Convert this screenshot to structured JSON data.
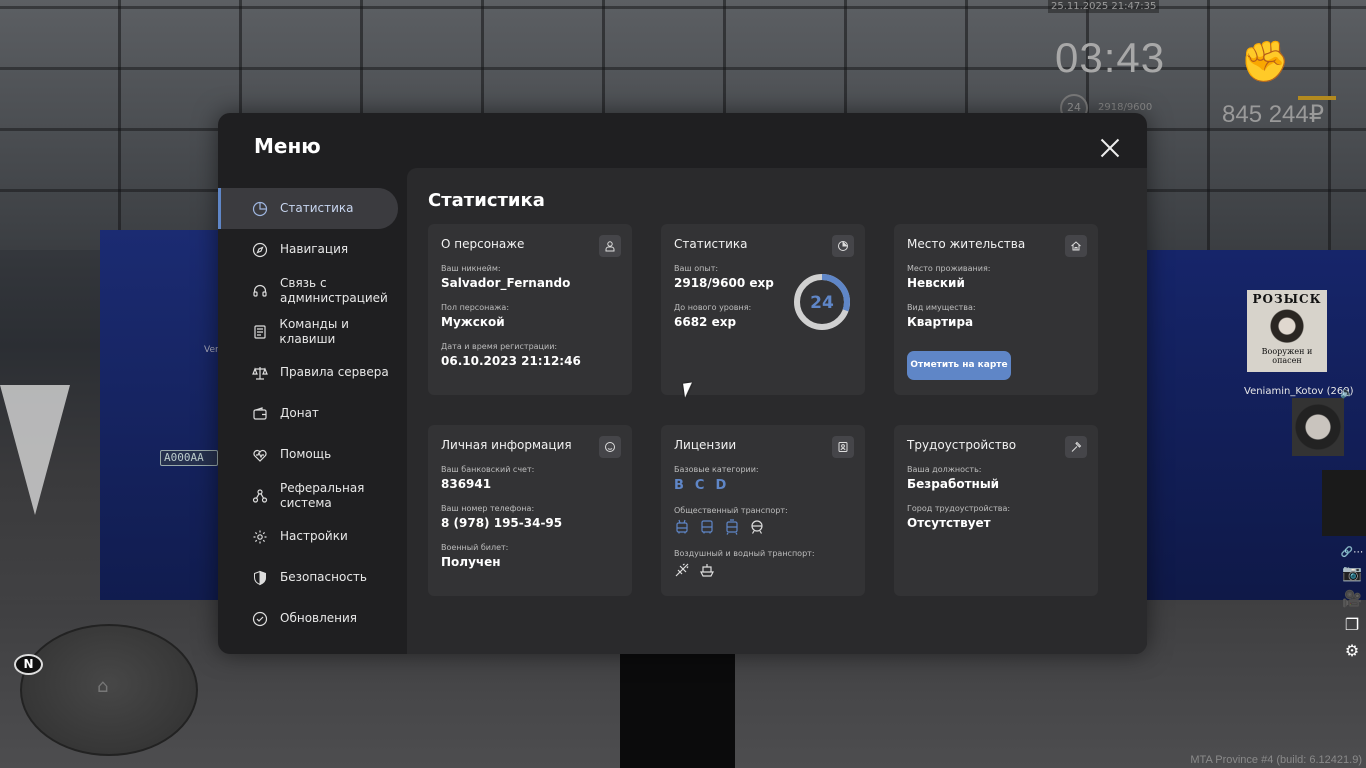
{
  "hud": {
    "datetime": "25.11.2025 21:47:35",
    "clock": "03:43",
    "level": "24",
    "exp": "2918/9600",
    "money": "845 244₽",
    "build": "MTA Province #4 (build: 6.12421.9)"
  },
  "world": {
    "plate": "A000AA",
    "player_name": "Veniamin_Kotov (269)",
    "poster_top": "РОЗЫСК",
    "poster_bottom": "Вооружен и опасен",
    "name_fragment": "Ven",
    "north": "N"
  },
  "menu": {
    "title": "Меню",
    "sidebar": [
      {
        "label": "Статистика",
        "icon": "pie-chart-icon"
      },
      {
        "label": "Навигация",
        "icon": "compass-icon"
      },
      {
        "label": "Связь с администрацией",
        "icon": "headset-icon"
      },
      {
        "label": "Команды и клавиши",
        "icon": "keyboard-icon"
      },
      {
        "label": "Правила сервера",
        "icon": "scales-icon"
      },
      {
        "label": "Донат",
        "icon": "wallet-icon"
      },
      {
        "label": "Помощь",
        "icon": "heart-icon"
      },
      {
        "label": "Реферальная система",
        "icon": "network-icon"
      },
      {
        "label": "Настройки",
        "icon": "gear-icon"
      },
      {
        "label": "Безопасность",
        "icon": "shield-icon"
      },
      {
        "label": "Обновления",
        "icon": "refresh-icon"
      }
    ],
    "content_title": "Статистика"
  },
  "cards": {
    "character": {
      "title": "О персонаже",
      "nick_label": "Ваш никнейм:",
      "nick": "Salvador_Fernando",
      "gender_label": "Пол персонажа:",
      "gender": "Мужской",
      "reg_label": "Дата и время регистрации:",
      "reg": "06.10.2023 21:12:46"
    },
    "stats": {
      "title": "Статистика",
      "exp_label": "Ваш опыт:",
      "exp": "2918/9600 exp",
      "next_label": "До нового уровня:",
      "next": "6682 exp",
      "level": "24",
      "progress": 0.304
    },
    "residence": {
      "title": "Место жительства",
      "place_label": "Место проживания:",
      "place": "Невский",
      "type_label": "Вид имущества:",
      "type": "Квартира",
      "button": "Отметить на карте"
    },
    "personal": {
      "title": "Личная информация",
      "bank_label": "Ваш банковский счет:",
      "bank": "836941",
      "phone_label": "Ваш номер телефона:",
      "phone": "8 (978) 195-34-95",
      "military_label": "Военный билет:",
      "military": "Получен"
    },
    "licenses": {
      "title": "Лицензии",
      "basic_label": "Базовые категории:",
      "categories": [
        "B",
        "C",
        "D"
      ],
      "public_label": "Общественный транспорт:",
      "air_label": "Воздушный и водный транспорт:"
    },
    "employment": {
      "title": "Трудоустройство",
      "post_label": "Ваша должность:",
      "post": "Безработный",
      "city_label": "Город трудоустройства:",
      "city": "Отсутствует"
    }
  },
  "colors": {
    "accent": "#5f86c7",
    "panel": "#1f1f21",
    "card": "#333335"
  }
}
